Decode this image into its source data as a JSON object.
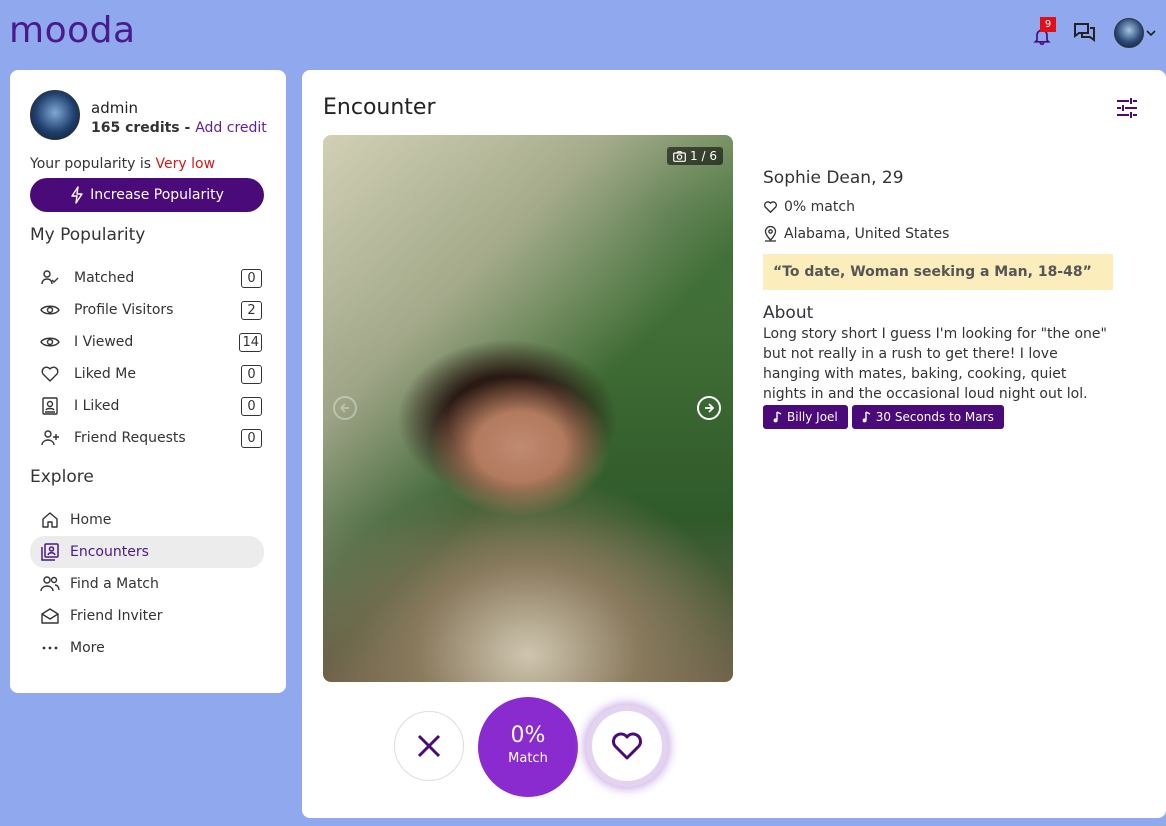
{
  "header": {
    "logo": "mooda",
    "notifications_count": "9"
  },
  "sidebar": {
    "user_name": "admin",
    "credits": "165 credits",
    "credits_sep": " - ",
    "add_credit": "Add credit",
    "popularity_prefix": "Your popularity is ",
    "popularity_value": "Very low",
    "increase_button": "Increase Popularity",
    "my_popularity_heading": "My Popularity",
    "popularity_items": [
      {
        "label": "Matched",
        "count": "0",
        "icon": "user-check-icon"
      },
      {
        "label": "Profile Visitors",
        "count": "2",
        "icon": "eye-icon"
      },
      {
        "label": "I Viewed",
        "count": "14",
        "icon": "eye-icon"
      },
      {
        "label": "Liked Me",
        "count": "0",
        "icon": "heart-icon"
      },
      {
        "label": "I Liked",
        "count": "0",
        "icon": "profile-card-icon"
      },
      {
        "label": "Friend Requests",
        "count": "0",
        "icon": "user-plus-icon"
      }
    ],
    "explore_heading": "Explore",
    "explore_items": [
      {
        "label": "Home",
        "icon": "home-icon"
      },
      {
        "label": "Encounters",
        "icon": "encounters-icon",
        "active": true
      },
      {
        "label": "Find a Match",
        "icon": "users-icon"
      },
      {
        "label": "Friend Inviter",
        "icon": "envelope-icon"
      },
      {
        "label": "More",
        "icon": "more-dots-icon"
      }
    ]
  },
  "main": {
    "title": "Encounter",
    "photo_counter": "1 / 6",
    "profile": {
      "name_age": "Sophie Dean, 29",
      "match": "0% match",
      "location": "Alabama, United States",
      "quote": "“To date, Woman seeking a Man, 18-48”",
      "about_heading": "About",
      "about_text": "Long story short I guess I'm looking for \"the one\" but not really in a rush to get there! I love hanging with mates, baking, cooking, quiet nights in and the occasional loud night out lol.",
      "music_tags": [
        "Billy Joel",
        "30 Seconds to Mars"
      ]
    },
    "match_percent": "0%",
    "match_label": "Match"
  },
  "colors": {
    "background": "#8fa8ee",
    "brand_purple": "#4a0a7a",
    "match_purple": "#8a2bd0",
    "popularity_low": "#d0191a",
    "quote_bg": "#fcedbd"
  }
}
